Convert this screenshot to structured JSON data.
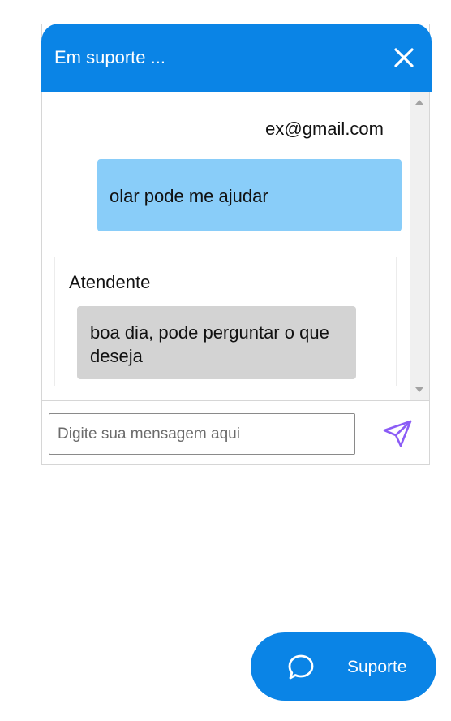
{
  "header": {
    "title": "Em suporte ...",
    "close_icon": "close-icon"
  },
  "messages": {
    "user": {
      "email": "ex@gmail.com",
      "text": "olar pode me ajudar"
    },
    "agent": {
      "name": "Atendente",
      "text": "boa dia, pode perguntar o que deseja"
    }
  },
  "composer": {
    "placeholder": "Digite sua mensagem aqui",
    "value": "",
    "send_icon": "send-icon"
  },
  "support_button": {
    "label": "Suporte",
    "icon": "chat-bubble-icon"
  },
  "colors": {
    "accent": "#0a84e6",
    "user_bubble": "#89cdf9",
    "agent_bubble": "#d3d3d3",
    "send_icon": "#8b5cf6"
  }
}
